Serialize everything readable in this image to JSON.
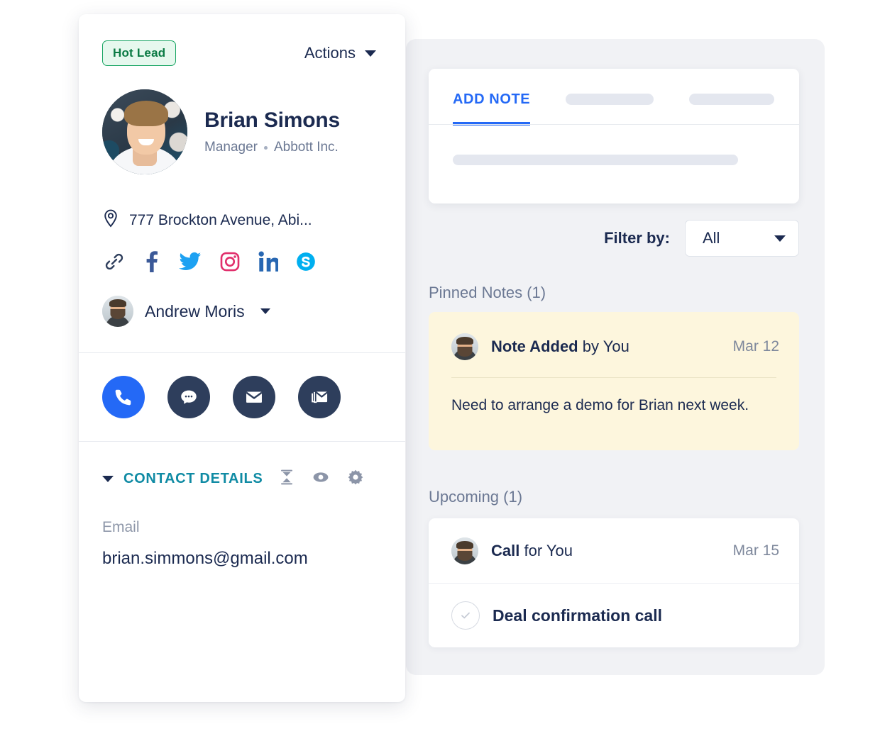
{
  "contact_card": {
    "badge": "Hot Lead",
    "actions_label": "Actions",
    "name": "Brian Simons",
    "title": "Manager",
    "company": "Abbott Inc.",
    "address": "777 Brockton Avenue, Abi...",
    "social_links": [
      {
        "name": "website-link-icon",
        "color": "#2e3e5c"
      },
      {
        "name": "facebook-icon",
        "color": "#3b5998"
      },
      {
        "name": "twitter-icon",
        "color": "#1da1f2"
      },
      {
        "name": "instagram-icon",
        "color": "#e1306c"
      },
      {
        "name": "linkedin-icon",
        "color": "#2867b2"
      },
      {
        "name": "skype-icon",
        "color": "#00aff0"
      }
    ],
    "owner": "Andrew Moris",
    "quick_actions": [
      {
        "name": "call-button",
        "icon": "phone-icon",
        "color": "#2469f6"
      },
      {
        "name": "sms-button",
        "icon": "chat-bubble-icon",
        "color": "#2e3e5c"
      },
      {
        "name": "email-button",
        "icon": "envelope-icon",
        "color": "#2e3e5c"
      },
      {
        "name": "bulk-email-button",
        "icon": "stacked-envelopes-icon",
        "color": "#2e3e5c"
      }
    ],
    "details_section_title": "CONTACT DETAILS",
    "details_icons": [
      "collapse-icon",
      "eye-icon",
      "gear-icon"
    ],
    "fields": [
      {
        "label": "Email",
        "value": "brian.simmons@gmail.com"
      }
    ]
  },
  "activity_panel": {
    "tabs": [
      {
        "label": "ADD NOTE",
        "active": true
      },
      {
        "label": "",
        "active": false
      },
      {
        "label": "",
        "active": false
      }
    ],
    "filter_label": "Filter by:",
    "filter_value": "All",
    "pinned": {
      "title": "Pinned Notes (1)",
      "note": {
        "action": "Note Added",
        "by": "by You",
        "date": "Mar 12",
        "body": "Need to arrange a demo for Brian next week."
      }
    },
    "upcoming": {
      "title": "Upcoming (1)",
      "items": [
        {
          "action": "Call",
          "by": "for You",
          "date": "Mar 15"
        },
        {
          "task": "Deal confirmation call"
        }
      ]
    }
  },
  "colors": {
    "accent_blue": "#2469f6",
    "navy": "#1b2a50",
    "teal": "#108ba4",
    "badge_green": "#0b7a44",
    "note_yellow": "#fdf6dd",
    "panel_grey": "#f1f2f5"
  }
}
